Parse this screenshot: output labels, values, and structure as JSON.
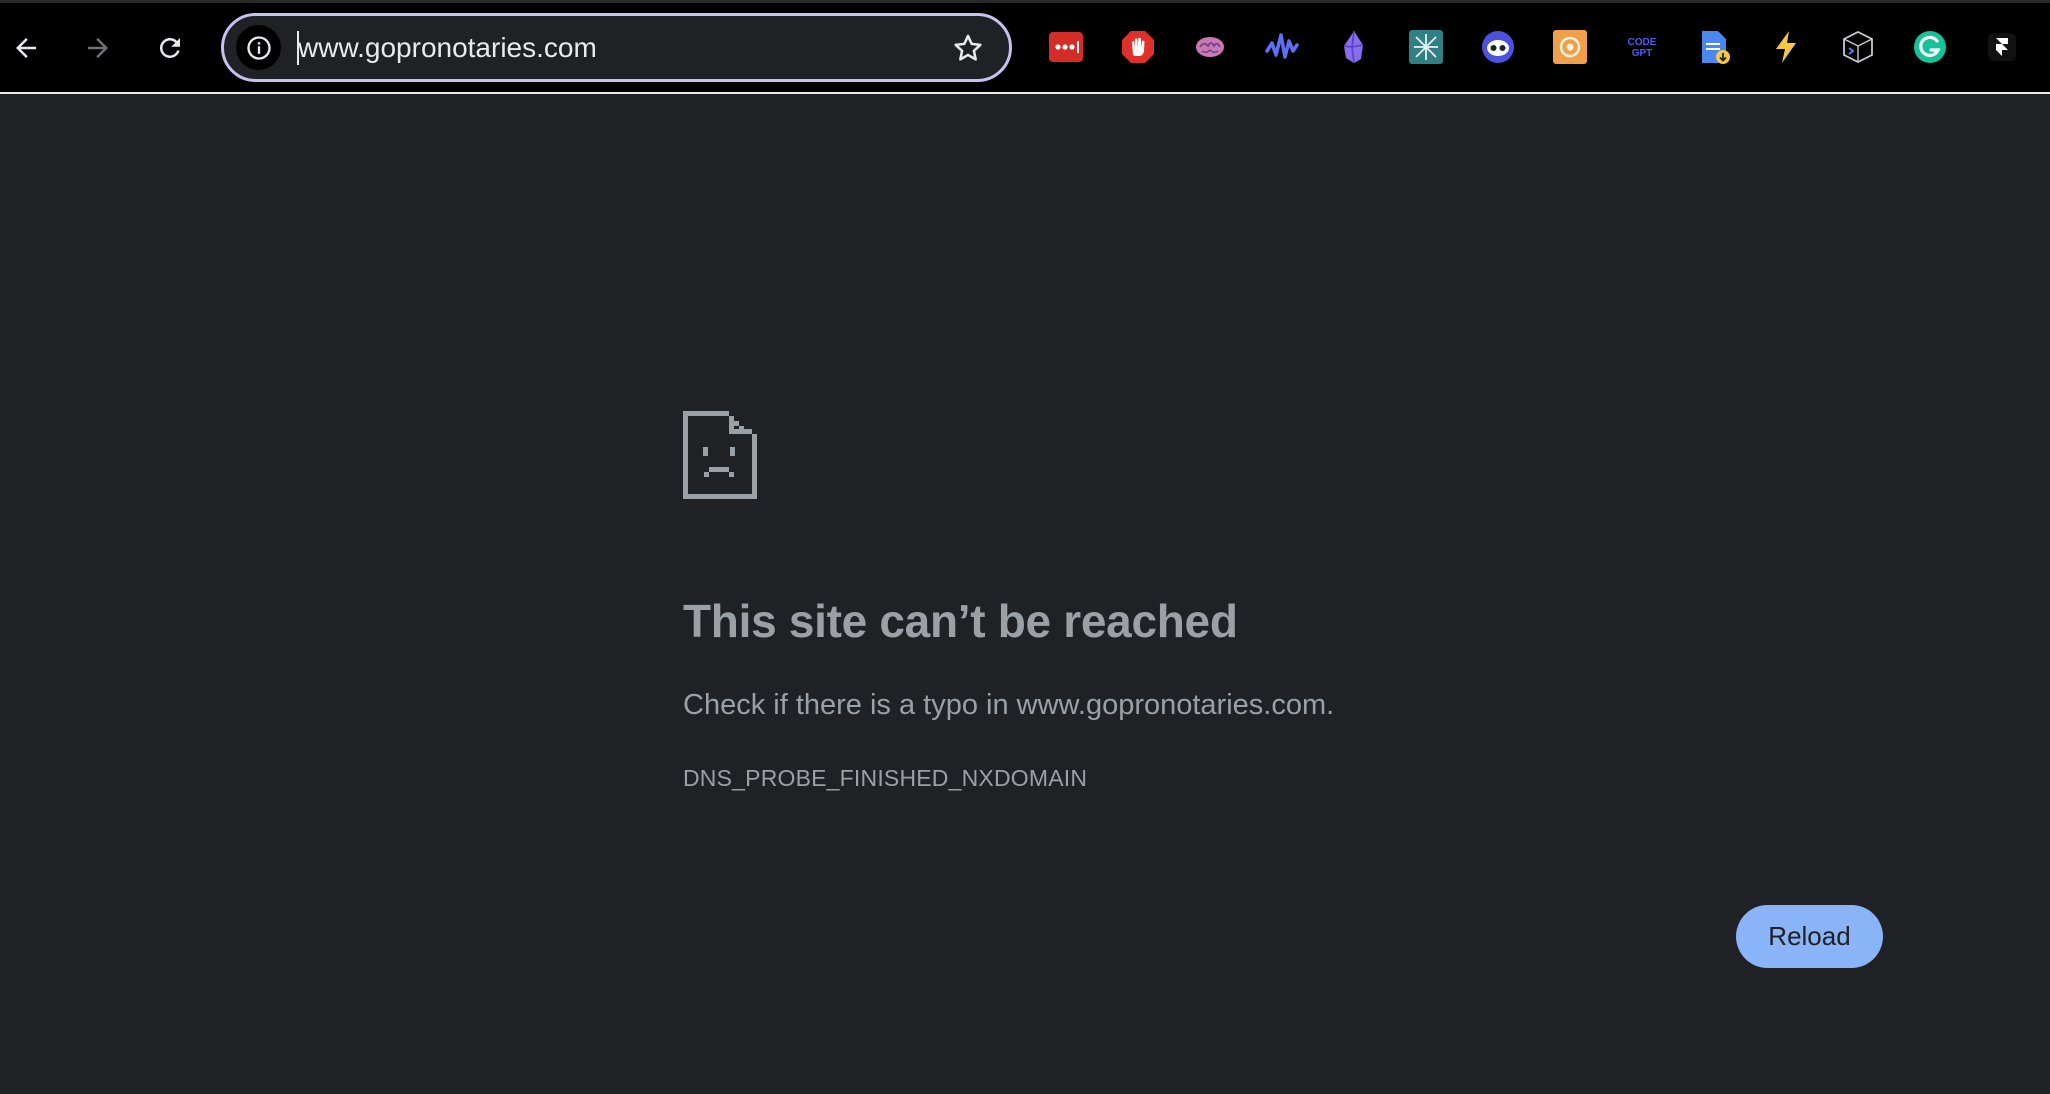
{
  "browser": {
    "url": "www.gopronotaries.com",
    "nav_icons": [
      "back-arrow-icon",
      "forward-arrow-icon",
      "reload-icon"
    ],
    "omnibox_icons": [
      "site-info-icon",
      "bookmark-star-icon"
    ],
    "extensions": [
      {
        "name": "lastpass",
        "color": "#d32d27"
      },
      {
        "name": "adblock",
        "color": "#e0302c"
      },
      {
        "name": "brain",
        "color": "#c97ab5"
      },
      {
        "name": "voice-wave",
        "color": "#5d6ff2"
      },
      {
        "name": "crystal",
        "color": "#8a6cf0"
      },
      {
        "name": "teal-logo",
        "color": "#2f7f85"
      },
      {
        "name": "eye-bot",
        "color": "#4b52e0"
      },
      {
        "name": "orange-badge",
        "color": "#f0a04b"
      },
      {
        "name": "codegpt",
        "color": "#4a5cf5",
        "label_line1": "CODE",
        "label_line2": "GPT"
      },
      {
        "name": "doc-download",
        "color": "#4a88f0"
      },
      {
        "name": "lightning",
        "color": "#f6c744"
      },
      {
        "name": "cube-code",
        "color": "#c8c8d0"
      },
      {
        "name": "grammarly",
        "color": "#15c39a"
      },
      {
        "name": "framer",
        "color": "#ffffff"
      }
    ]
  },
  "error": {
    "icon": "sad-document-icon",
    "title": "This site can’t be reached",
    "description": "Check if there is a typo in www.gopronotaries.com.",
    "code": "DNS_PROBE_FINISHED_NXDOMAIN",
    "reload_label": "Reload",
    "reload_color": "#8ab4f8"
  },
  "colors": {
    "page_background": "#202124",
    "toolbar_background": "#000000",
    "omnibox_focus_ring": "#c4c3ef",
    "text_muted": "#9aa0a6"
  }
}
